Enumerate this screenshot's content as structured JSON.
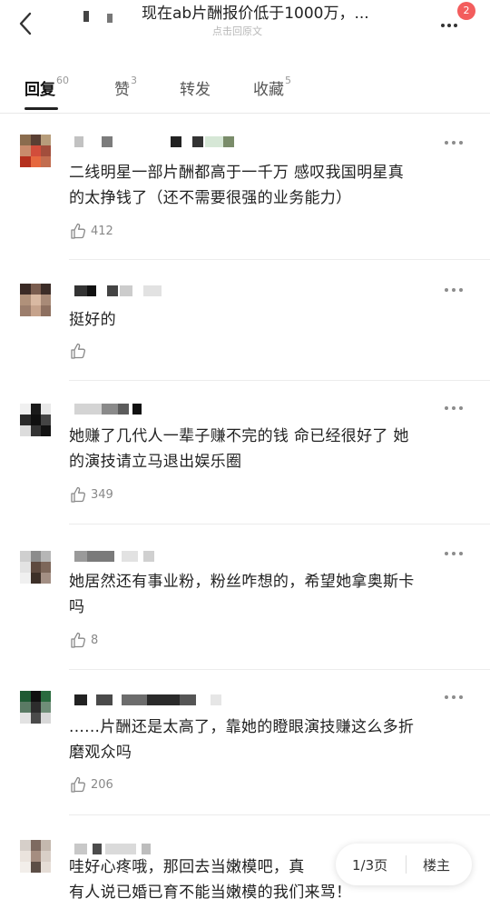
{
  "header": {
    "title": "现在ab片酬报价低于1000万，...",
    "subtitle": "点击回原文",
    "badge": "2"
  },
  "tabs": [
    {
      "label": "回复",
      "count": "60"
    },
    {
      "label": "赞",
      "count": "3"
    },
    {
      "label": "转发",
      "count": ""
    },
    {
      "label": "收藏",
      "count": "5"
    }
  ],
  "comments": [
    {
      "lines": [
        "二线明星一部片酬都高于一千万 感叹我国明星真",
        "的太挣钱了（还不需要很强的业务能力）"
      ],
      "likes": "412"
    },
    {
      "lines": [
        "挺好的"
      ],
      "likes": ""
    },
    {
      "lines": [
        "她赚了几代人一辈子赚不完的钱 命已经很好了 她",
        "的演技请立马退出娱乐圈"
      ],
      "likes": "349"
    },
    {
      "lines": [
        "她居然还有事业粉，粉丝咋想的，希望她拿奥斯卡",
        "吗"
      ],
      "likes": "8"
    },
    {
      "lines": [
        "......片酬还是太高了，靠她的瞪眼演技赚这么多折",
        "磨观众吗"
      ],
      "likes": "206"
    },
    {
      "lines": [
        "哇好心疼哦，那回去当嫩模吧，真",
        "有人说已婚已育不能当嫩模的我们来骂！"
      ],
      "likes": ""
    }
  ],
  "pager": {
    "page": "1/3页",
    "owner": "楼主"
  },
  "colors": {
    "badge": "#f35d5d",
    "tab_underline": "#222222",
    "muted_text": "#888888"
  }
}
